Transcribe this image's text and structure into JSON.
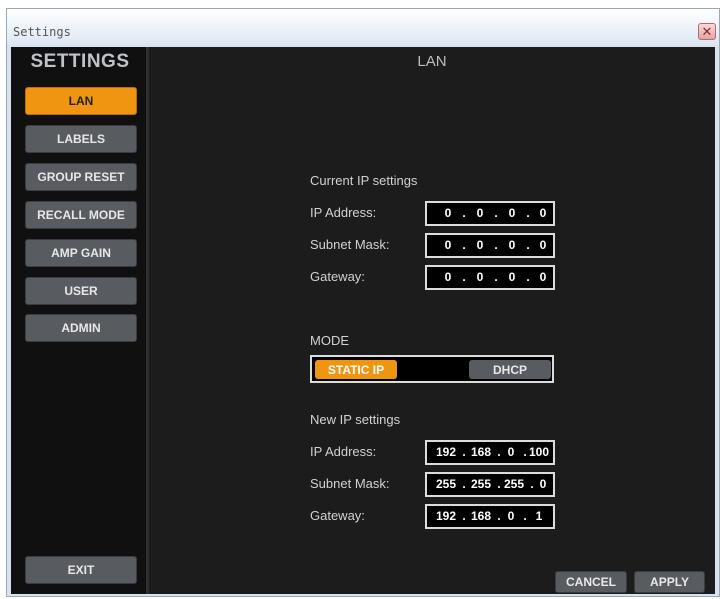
{
  "window": {
    "title": "Settings",
    "close_glyph": "✕"
  },
  "sidebar": {
    "title": "SETTINGS",
    "items": [
      {
        "label": "LAN",
        "active": true
      },
      {
        "label": "LABELS"
      },
      {
        "label": "GROUP RESET"
      },
      {
        "label": "RECALL MODE"
      },
      {
        "label": "AMP GAIN"
      },
      {
        "label": "USER"
      },
      {
        "label": "ADMIN"
      }
    ],
    "exit_label": "EXIT"
  },
  "content": {
    "title": "LAN",
    "current": {
      "heading": "Current IP settings",
      "ip": {
        "label": "IP Address:",
        "octets": [
          "0",
          "0",
          "0",
          "0"
        ]
      },
      "subnet": {
        "label": "Subnet Mask:",
        "octets": [
          "0",
          "0",
          "0",
          "0"
        ]
      },
      "gateway": {
        "label": "Gateway:",
        "octets": [
          "0",
          "0",
          "0",
          "0"
        ]
      }
    },
    "mode": {
      "heading": "MODE",
      "static_label": "STATIC IP",
      "dhcp_label": "DHCP",
      "selected": "STATIC IP"
    },
    "new": {
      "heading": "New IP settings",
      "ip": {
        "label": "IP Address:",
        "octets": [
          "192",
          "168",
          "0",
          "100"
        ]
      },
      "subnet": {
        "label": "Subnet Mask:",
        "octets": [
          "255",
          "255",
          "255",
          "0"
        ]
      },
      "gateway": {
        "label": "Gateway:",
        "octets": [
          "192",
          "168",
          "0",
          "1"
        ]
      }
    },
    "cancel_label": "CANCEL",
    "apply_label": "APPLY"
  },
  "colors": {
    "accent": "#f09512",
    "button": "#585c61",
    "panel": "#1c1c1c",
    "sidebar": "#101010"
  }
}
